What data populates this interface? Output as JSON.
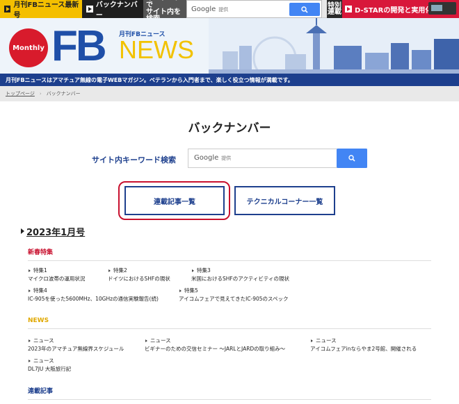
{
  "topbar": {
    "latest": "月刊FBニュース最新号",
    "back": "バックナンバー",
    "keyword_label": "キーワードで\nサイト内を検索",
    "search_brand": "Google",
    "search_brand_sub": "提供",
    "special_label": "特別\n連載",
    "dstar": "D-STARの開発と実用化"
  },
  "header": {
    "badge": "Monthly",
    "logo_fb": "FB",
    "logo_sub": "月刊FBニュース",
    "logo_news": "NEWS",
    "tagline": "月刊FBニュースはアマチュア無線の電子WEBマガジン。ベテランから入門者まで、楽しく役立つ情報が満載です。"
  },
  "breadcrumb": {
    "home": "トップページ",
    "current": "バックナンバー"
  },
  "main": {
    "title": "バックナンバー",
    "keyword_search_label": "サイト内キーワード検索",
    "search_brand": "Google",
    "search_brand_sub": "提供",
    "serial_button": "連載記事一覧",
    "tech_button": "テクニカルコーナー一覧",
    "issue": "2023年1月号"
  },
  "sections": {
    "special": {
      "heading": "新春特集",
      "items": [
        {
          "cat": "特集1",
          "title": "マイクロ波帯の運用状況"
        },
        {
          "cat": "特集2",
          "title": "ドイツにおけるSHFの現状"
        },
        {
          "cat": "特集3",
          "title": "米国におけるSHFのアクティビティの現状"
        },
        {
          "cat": "特集4",
          "title": "IC-905を使った5600MHz、10GHzの通信実験報告(続)"
        },
        {
          "cat": "特集5",
          "title": "アイコムフェアで見えてきたIC-905のスペック"
        }
      ]
    },
    "news": {
      "heading": "NEWS",
      "items": [
        {
          "cat": "ニュース",
          "title": "2023年のアマチュア無線界スケジュール"
        },
        {
          "cat": "ニュース",
          "title": "ビギナーのための交信セミナー 〜JARLとJARDの取り組み〜"
        },
        {
          "cat": "ニュース",
          "title": "アイコムフェアinならやま2号館、開催される"
        },
        {
          "cat": "ニュース",
          "title": "DL7JU 大阪旅行記"
        }
      ]
    },
    "serial": {
      "heading": "連載記事"
    }
  },
  "colors": {
    "brand_blue": "#1d3f8d",
    "accent_red": "#c8102e",
    "news_gold": "#e0a800",
    "google_blue": "#4285f4"
  }
}
